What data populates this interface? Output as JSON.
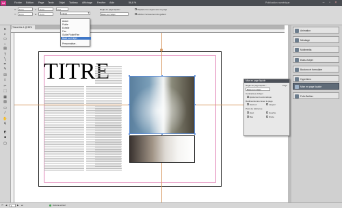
{
  "app": {
    "logo": "Id",
    "workspace": "Publication numérique"
  },
  "menu": [
    "Fichier",
    "Edition",
    "Page",
    "Texte",
    "Objet",
    "Tableau",
    "Affichage",
    "Fenêtre",
    "Aide"
  ],
  "zoom": "56,8 %",
  "controls": {
    "x_label": "X:",
    "x_value": "0 cm",
    "y_label": "Y:",
    "y_value": "0 cm",
    "l_label": "L:",
    "l_value": "0 cm",
    "h_label": "H:",
    "h_value": "0 cm",
    "stroke_weight": "0 pt",
    "fit_value": "Fluide",
    "fit_dropdown_value": "Fluide",
    "page_rule_label": "Règle de page liquide :",
    "page_rule_value": "Basé sur l'objet",
    "chk1": "Déplacer les objets avec la page",
    "chk2": "Afficher l'écrasement du gabarit"
  },
  "doc_tab": "*Sans titre-1 @ 55%",
  "dropdown": {
    "items": [
      "Aucun",
      "Fluide",
      "Echelle",
      "Fixe",
      "Guide Fluide/Fixe",
      "Basé sur l'objet",
      "Personnaliser..."
    ],
    "selected_index": 5
  },
  "document": {
    "title": "TITRE"
  },
  "panels": [
    {
      "label": "Animation",
      "active": false
    },
    {
      "label": "Minutage",
      "active": false
    },
    {
      "label": "Multimédia",
      "active": false
    },
    {
      "label": "Etats d'objet",
      "active": false
    },
    {
      "label": "Boutons et formulaire",
      "active": false
    },
    {
      "label": "Hyperliens",
      "active": false
    },
    {
      "label": "Mise en page liquide",
      "active": true
    },
    {
      "label": "Folio Builder",
      "active": false
    }
  ],
  "liquid_panel": {
    "title": "Mise en page liquide",
    "rule_label": "Règle de page liquide :",
    "rule_value": "Basé sur l'objet",
    "constraints_label": "Contraintes d'objet :",
    "size_label": "Redimensionner avec la page",
    "height_label": "Hauteur",
    "width_label": "Largeur",
    "pin_label": "Point de référence",
    "top_label": "Haut",
    "bottom_label": "Bas",
    "left_label": "Gauche",
    "right_label": "Droite",
    "auto_label": "Ajustement automatique",
    "preview_label": "Page"
  },
  "status": {
    "page": "1",
    "errors": "Aucune erreur"
  }
}
